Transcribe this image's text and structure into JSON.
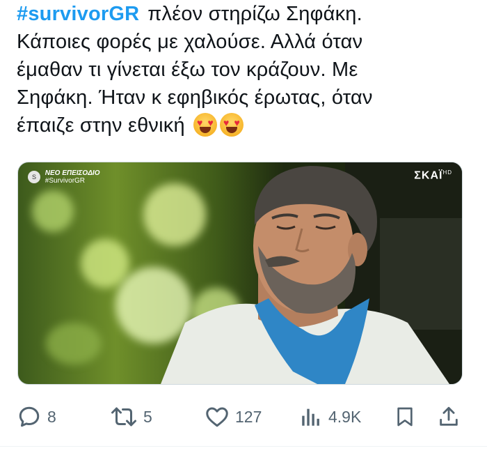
{
  "tweet": {
    "hashtag": "#survivorGR",
    "line1": "πλέον στηρίζω Σηφάκη.",
    "line2": "Κάποιες φορές με χαλούσε. Αλλά όταν",
    "line3": "έμαθαν τι γίνεται έξω τον κράζουν. Με",
    "line4": "Σηφάκη. Ήταν κ εφηβικός έρωτας, όταν",
    "line5": "έπαιζε στην εθνική",
    "emoji": "smiling-face-with-heart-eyes"
  },
  "media": {
    "overlay_left_line1": "ΝΕΟ ΕΠΕΙΣΟΔΙΟ",
    "overlay_left_line2": "#SurvivorGR",
    "channel_logo": "ΣΚΑΪ",
    "channel_hd": "HD"
  },
  "actions": {
    "replies": "8",
    "retweets": "5",
    "likes": "127",
    "views": "4.9K"
  },
  "colors": {
    "accent": "#1d9bf0",
    "text": "#0f1419",
    "muted": "#536471"
  }
}
